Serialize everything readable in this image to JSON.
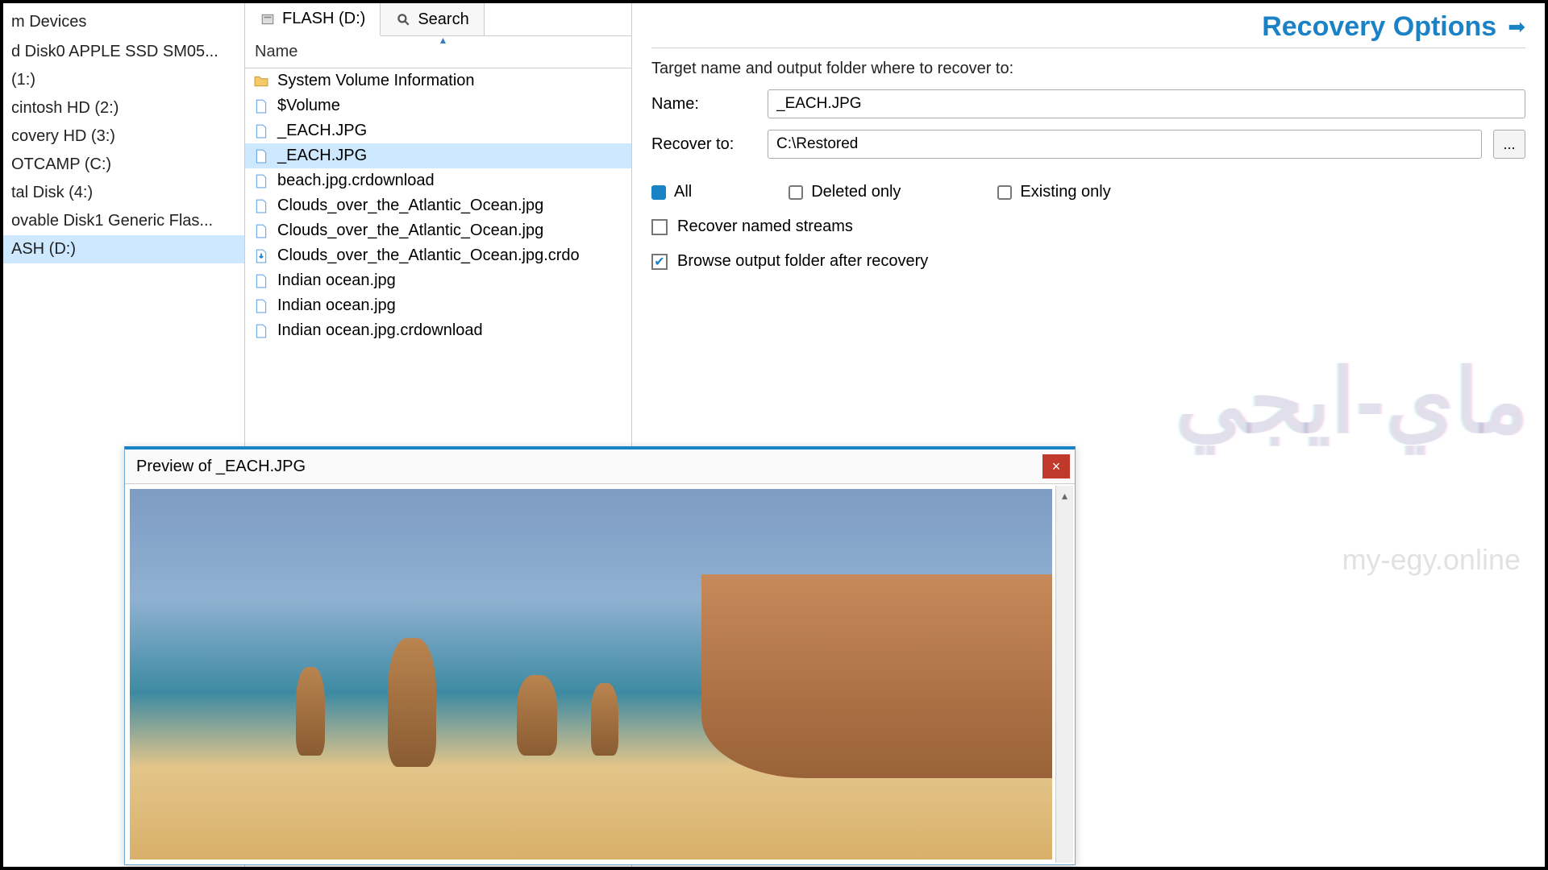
{
  "sidebar": {
    "heading": "m Devices",
    "items": [
      {
        "label": "d Disk0 APPLE SSD SM05..."
      },
      {
        "label": "(1:)"
      },
      {
        "label": "cintosh HD (2:)"
      },
      {
        "label": "covery HD (3:)"
      },
      {
        "label": "OTCAMP (C:)"
      },
      {
        "label": "tal Disk (4:)"
      },
      {
        "label": "ovable Disk1 Generic Flas..."
      },
      {
        "label": "ASH (D:)",
        "selected": true
      }
    ]
  },
  "tabs": {
    "flash": "FLASH (D:)",
    "search": "Search"
  },
  "column_header": "Name",
  "files": [
    {
      "icon": "folder",
      "label": "System Volume Information"
    },
    {
      "icon": "file",
      "label": "$Volume"
    },
    {
      "icon": "file",
      "label": "_EACH.JPG"
    },
    {
      "icon": "file",
      "label": "_EACH.JPG",
      "selected": true
    },
    {
      "icon": "file",
      "label": "beach.jpg.crdownload"
    },
    {
      "icon": "file",
      "label": "Clouds_over_the_Atlantic_Ocean.jpg"
    },
    {
      "icon": "file",
      "label": "Clouds_over_the_Atlantic_Ocean.jpg"
    },
    {
      "icon": "download",
      "label": "Clouds_over_the_Atlantic_Ocean.jpg.crdo"
    },
    {
      "icon": "file",
      "label": "Indian ocean.jpg"
    },
    {
      "icon": "file",
      "label": "Indian ocean.jpg"
    },
    {
      "icon": "file",
      "label": "Indian ocean.jpg.crdownload"
    }
  ],
  "recovery": {
    "title": "Recovery Options",
    "sub": "Target name and output folder where to recover to:",
    "name_label": "Name:",
    "name_value": "_EACH.JPG",
    "to_label": "Recover to:",
    "to_value": "C:\\Restored",
    "opt_all": "All",
    "opt_deleted": "Deleted only",
    "opt_existing": "Existing only",
    "chk_streams": "Recover named streams",
    "chk_browse": "Browse output folder after recovery"
  },
  "preview": {
    "title": "Preview of _EACH.JPG",
    "close": "×"
  },
  "watermark": {
    "main": "ماي-ايجي",
    "sub": "my-egy.online"
  },
  "browse_btn": "..."
}
